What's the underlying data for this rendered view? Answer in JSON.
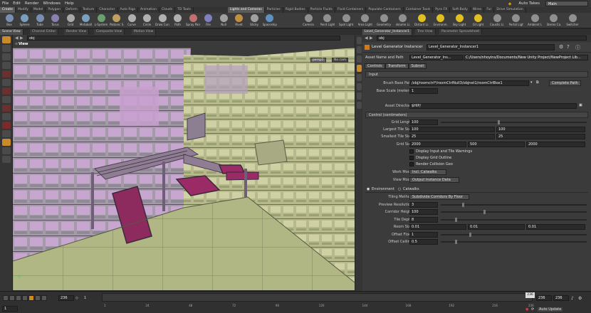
{
  "menu": {
    "items": [
      "File",
      "Edit",
      "Render",
      "Windows",
      "Help"
    ],
    "auto_takes": "Auto Takes",
    "desktop": "Main"
  },
  "shelf_tabs_left": [
    "Create",
    "Modify",
    "Model",
    "Polygon",
    "Deform",
    "Texture",
    "Character",
    "Auto Rigs",
    "Animation",
    "Clouds",
    "TD Tools"
  ],
  "shelf_tabs_right": [
    "Lights and Cameras",
    "Particles",
    "Rigid Bodies",
    "Particle Fluids",
    "Fluid Containers",
    "Populate Containers",
    "Container Tools",
    "Pyro FX",
    "Soft Body",
    "Wires",
    "Fur",
    "Drive Simulation"
  ],
  "tools_left": [
    "Box",
    "Sphere",
    "Tube",
    "Torus",
    "Grid",
    "Metaball",
    "L-System",
    "Platonic S.",
    "Curve",
    "Circle",
    "Draw Curve",
    "Path",
    "Spray Paint",
    "File",
    "Null",
    "Rivet",
    "Sticky",
    "Spaceship"
  ],
  "tools_right": [
    "Camera",
    "Point Light",
    "Spot Light",
    "Area Light",
    "Geometry",
    "Volume Li.",
    "Distant Li.",
    "Environm.",
    "Sky Light",
    "GI Light",
    "Caustic Li.",
    "Portal Light",
    "Ambient L.",
    "Stereo Ca.",
    "Switcher"
  ],
  "pane_tabs_left": [
    "Scene View",
    "Channel Editor",
    "Render View",
    "Composite View",
    "Motion View"
  ],
  "pane_tabs_right": [
    "Level_Generator_Instancer1",
    "Tree View",
    "Parameter Spreadsheet"
  ],
  "viewport": {
    "path": "obj",
    "title": "View",
    "camera": "persp1",
    "cam_menu": "No cam"
  },
  "params": {
    "path": "obj",
    "node_type": "Level Generator Instancer",
    "node_name": "Level_Generator_Instancer1",
    "asset_label": "Asset Name and Path",
    "asset_name": "Level_Generator_Ins...",
    "asset_path": "C:/Users/nhoyins/Documents/New Unity Project/NewProject Lib...",
    "tabs": [
      "Controls",
      "Transform",
      "Subnet"
    ],
    "input_section": "Input",
    "brush_label": "Brush Base Path",
    "brush_value": "/obj/roomctrl*/roomCtrlNull3/objnet1/roomCtrlBox1",
    "complete_path": "Complete Path",
    "base_scale_label": "Base Scale (meters)",
    "base_scale": "1",
    "asset_dir_label": "Asset Directory",
    "asset_dir": "$HIP/",
    "control_section": "Control (centimeters)",
    "grid_length_label": "Grid Length",
    "grid_length": "100",
    "largest_label": "Largest Tile Size",
    "largest_a": "100",
    "largest_b": "100",
    "smallest_label": "Smallest Tile Size",
    "smallest_a": "25",
    "smallest_b": "25",
    "grid_size_label": "Grid Size",
    "grid_size_a": "2000",
    "grid_size_b": "500",
    "grid_size_c": "2000",
    "chk1": "Display Input and Tile Warnings",
    "chk2": "Display Grid Outline",
    "chk3": "Render Collision Geo",
    "work_mode_label": "Work Mode",
    "work_mode": "Incl. Catwalks",
    "view_mode_label": "View Mode",
    "view_mode": "Output Instance Data",
    "env_tab": "Environment",
    "catwalks_tab": "Catwalks",
    "tiling_label": "Tiling Method",
    "tiling": "Subdivide Corridors By Floor",
    "preview_label": "Preview Resolution",
    "preview": "3",
    "corridor_label": "Corridor Height",
    "corridor": "100",
    "tile_depth_label": "Tile Depth",
    "tile_depth": "8",
    "room_size_label": "Room Size",
    "room_a": "0.01",
    "room_b": "0.01",
    "room_c": "0.01",
    "offset_floor_label": "Offset Floor",
    "offset_floor": "1",
    "offset_ceiling_label": "Offset Ceiling",
    "offset_ceiling": "0.5"
  },
  "timeline": {
    "current_frame": "236",
    "start": "1",
    "start_field": "1",
    "end_field": "236",
    "end_field2": "236",
    "ticks": [
      "1",
      "24",
      "48",
      "72",
      "96",
      "120",
      "144",
      "168",
      "192",
      "216",
      "236"
    ],
    "auto_update": "Auto Update"
  }
}
